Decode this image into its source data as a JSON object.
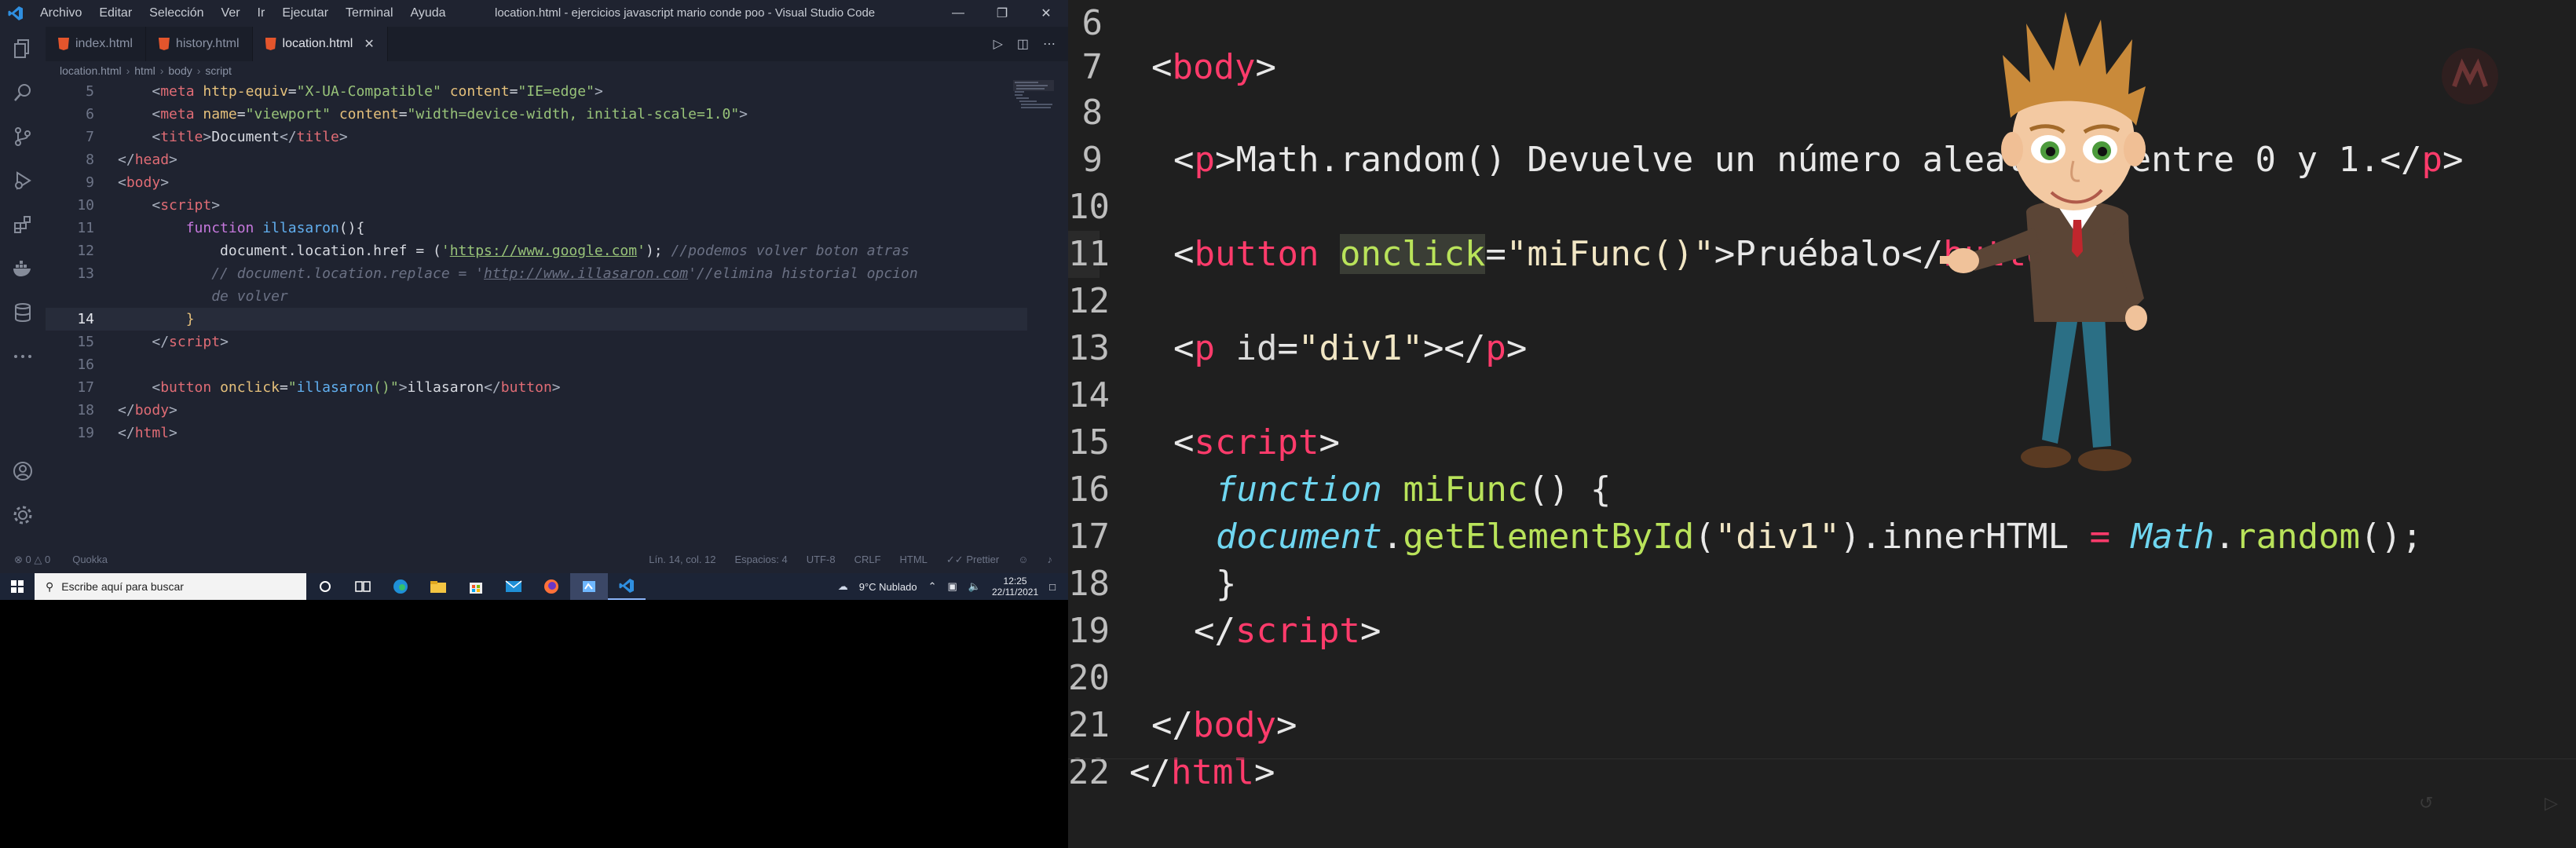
{
  "vscode": {
    "menu": [
      "Archivo",
      "Editar",
      "Selección",
      "Ver",
      "Ir",
      "Ejecutar",
      "Terminal",
      "Ayuda"
    ],
    "window_title": "location.html - ejercicios javascript mario conde poo - Visual Studio Code",
    "tabs": [
      {
        "label": "index.html",
        "active": false
      },
      {
        "label": "history.html",
        "active": false
      },
      {
        "label": "location.html",
        "active": true
      }
    ],
    "breadcrumb": [
      "location.html",
      "html",
      "body",
      "script"
    ],
    "status": {
      "errors": "0",
      "warnings": "0",
      "quokka": "Quokka",
      "position": "Lín. 14, col. 12",
      "spaces": "Espacios: 4",
      "encoding": "UTF-8",
      "eol": "CRLF",
      "language": "HTML",
      "formatter": "Prettier"
    }
  },
  "taskbar": {
    "search_placeholder": "Escribe aquí para buscar",
    "weather": "9°C  Nublado",
    "time": "12:25",
    "date": "22/11/2021"
  },
  "colors": {
    "accent": "#61afef",
    "tag": "#e06c75",
    "string": "#98c379",
    "slide_tag": "#ff3b6b",
    "slide_fn": "#b9e35a"
  }
}
